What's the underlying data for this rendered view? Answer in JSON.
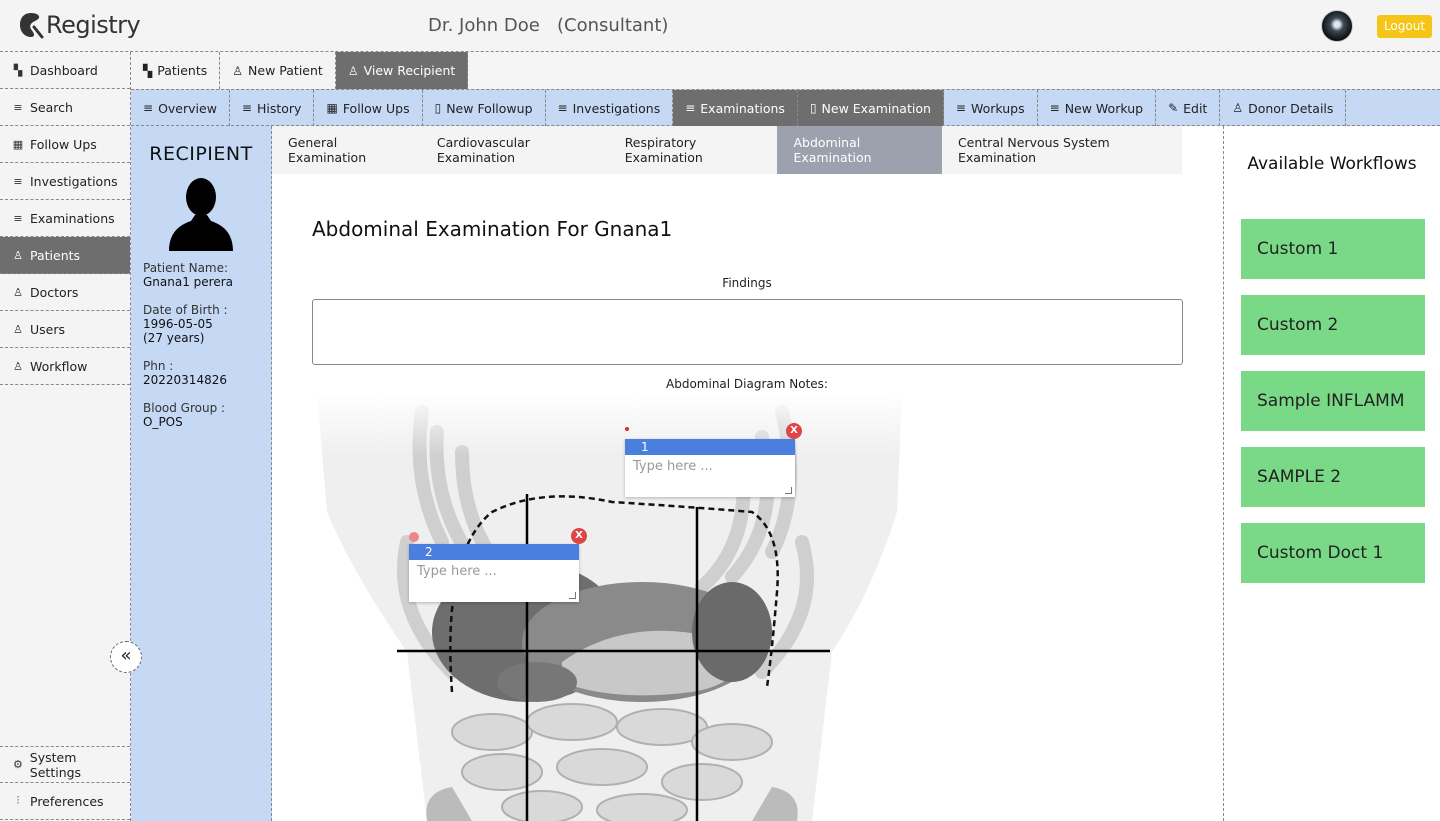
{
  "header": {
    "app_name": "Registry",
    "doctor": "Dr. John Doe   (Consultant)",
    "logout_label": "Logout"
  },
  "sidebar": {
    "items": [
      {
        "label": "Dashboard",
        "icon": "grid-icon"
      },
      {
        "label": "Search",
        "icon": "search-list-icon"
      },
      {
        "label": "Follow Ups",
        "icon": "calendar-icon"
      },
      {
        "label": "Investigations",
        "icon": "search-list-icon"
      },
      {
        "label": "Examinations",
        "icon": "search-list-icon"
      },
      {
        "label": "Patients",
        "icon": "person-icon",
        "active": true
      },
      {
        "label": "Doctors",
        "icon": "person-icon"
      },
      {
        "label": "Users",
        "icon": "person-icon"
      },
      {
        "label": "Workflow",
        "icon": "person-icon"
      }
    ],
    "bottom_items": [
      {
        "label": "System Settings",
        "icon": "gear-icon"
      },
      {
        "label": "Preferences",
        "icon": "sliders-icon"
      }
    ]
  },
  "top_tabs": [
    {
      "label": "Patients",
      "icon": "grid-icon"
    },
    {
      "label": "New Patient",
      "icon": "person-add-icon"
    },
    {
      "label": "View Recipient",
      "icon": "person-icon",
      "active": true
    }
  ],
  "sub_tabs": [
    {
      "label": "Overview",
      "icon": "search-list-icon"
    },
    {
      "label": "History",
      "icon": "search-list-icon"
    },
    {
      "label": "Follow Ups",
      "icon": "calendar-icon"
    },
    {
      "label": "New Followup",
      "icon": "file-icon"
    },
    {
      "label": "Investigations",
      "icon": "search-list-icon"
    },
    {
      "label": "Examinations",
      "icon": "search-list-icon",
      "active": true
    },
    {
      "label": "New Examination",
      "icon": "file-icon",
      "active": true
    },
    {
      "label": "Workups",
      "icon": "search-list-icon"
    },
    {
      "label": "New Workup",
      "icon": "search-list-icon"
    },
    {
      "label": "Edit",
      "icon": "pencil-icon"
    },
    {
      "label": "Donor Details",
      "icon": "person-icon"
    }
  ],
  "recipient": {
    "heading": "RECIPIENT",
    "name_label": "Patient Name:",
    "name": "Gnana1 perera",
    "dob_label": "Date of Birth :",
    "dob": "1996-05-05",
    "age": "(27 years)",
    "phn_label": "Phn :",
    "phn": "20220314826",
    "blood_label": "Blood Group :",
    "blood": "O_POS"
  },
  "exam_tabs": [
    {
      "label": "General Examination"
    },
    {
      "label": "Cardiovascular Examination"
    },
    {
      "label": "Respiratory Examination"
    },
    {
      "label": "Abdominal Examination",
      "active": true
    },
    {
      "label": "Central Nervous System Examination"
    }
  ],
  "exam": {
    "title": "Abdominal Examination For Gnana1",
    "findings_label": "Findings",
    "findings_value": "",
    "diagram_label": "Abdominal Diagram Notes:",
    "notes": [
      {
        "number": "1",
        "placeholder": "Type here ...",
        "close": "X"
      },
      {
        "number": "2",
        "placeholder": "Type here ...",
        "close": "X"
      }
    ]
  },
  "workflows": {
    "heading": "Available Workflows",
    "items": [
      "Custom 1",
      "Custom 2",
      "Sample INFLAMM",
      "SAMPLE 2",
      "Custom Doct 1"
    ],
    "color": "#79d987"
  }
}
